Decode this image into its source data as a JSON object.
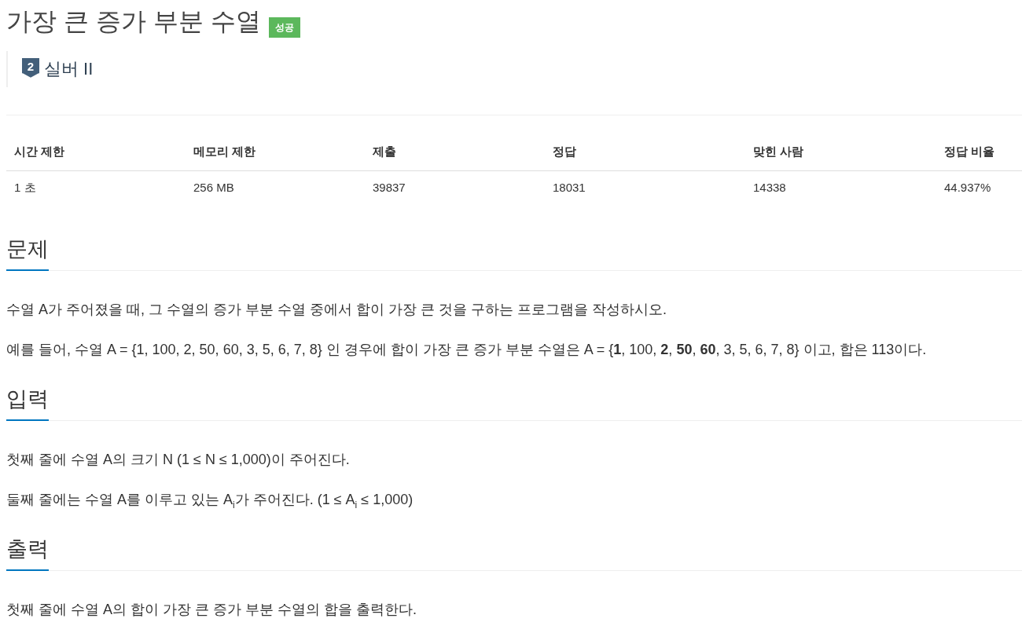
{
  "problem": {
    "title": "가장 큰 증가 부분 수열",
    "result_badge": {
      "label": "성공",
      "kind": "success"
    }
  },
  "tier": {
    "number": "2",
    "label": "실버 II",
    "kind": "silver"
  },
  "stats_table": {
    "columns": [
      "시간 제한",
      "메모리 제한",
      "제출",
      "정답",
      "맞힌 사람",
      "정답 비율"
    ],
    "rows": [
      [
        "1 초",
        "256 MB",
        "39837",
        "18031",
        "14338",
        "44.937%"
      ]
    ]
  },
  "sections": [
    {
      "heading": "문제",
      "paragraphs": [
        "수열 A가 주어졌을 때, 그 수열의 증가 부분 수열 중에서 합이 가장 큰 것을 구하는 프로그램을 작성하시오.",
        "예를 들어, 수열 A = {1, 100, 2, 50, 60, 3, 5, 6, 7, 8} 인 경우에 합이 가장 큰 증가 부분 수열은 A = {**1**, 100, **2**, **50**, **60**, 3, 5, 6, 7, 8} 이고, 합은 113이다."
      ]
    },
    {
      "heading": "입력",
      "paragraphs": [
        "첫째 줄에 수열 A의 크기 N (1 ≤ N ≤ 1,000)이 주어진다.",
        "둘째 줄에는 수열 A를 이루고 있는 A$_{i}$가 주어진다. (1 ≤ A$_{i}$ ≤ 1,000)"
      ]
    },
    {
      "heading": "출력",
      "paragraphs": [
        "첫째 줄에 수열 A의 합이 가장 큰 증가 부분 수열의 합을 출력한다."
      ]
    }
  ]
}
